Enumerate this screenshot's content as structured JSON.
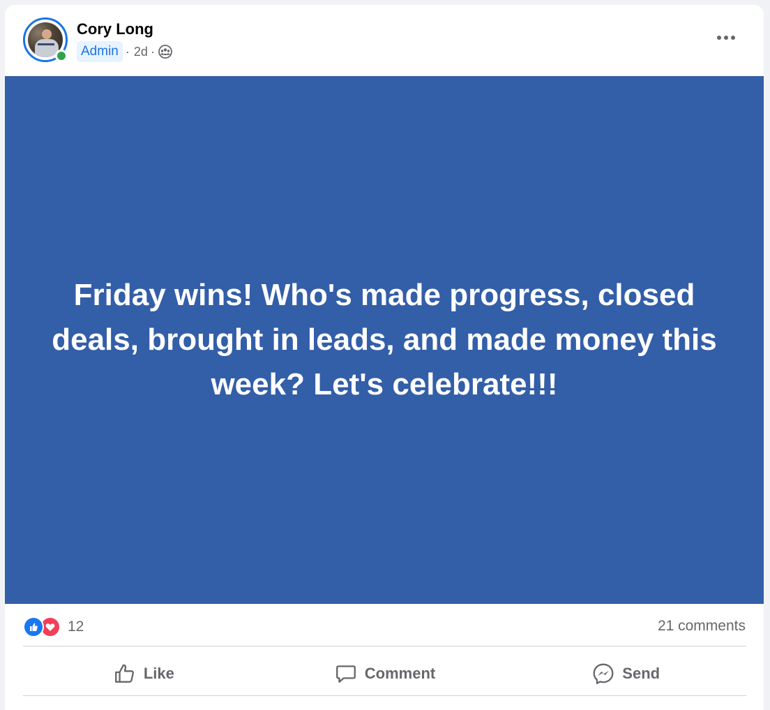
{
  "post": {
    "author": "Cory Long",
    "badge": "Admin",
    "time": "2d",
    "separator": "·",
    "audience_icon": "group-icon",
    "text": "Friday wins! Who's made progress, closed deals, brought in leads, and made money this week? Let's celebrate!!!",
    "background_color": "#335ea8",
    "text_color": "#ffffff"
  },
  "stats": {
    "reaction_icons": [
      "like-icon",
      "love-icon"
    ],
    "reaction_count": "12",
    "comments": "21 comments"
  },
  "actions": {
    "like": "Like",
    "comment": "Comment",
    "send": "Send"
  },
  "colors": {
    "accent": "#1b74e4",
    "online": "#31a24c",
    "secondary_text": "#65676b"
  }
}
